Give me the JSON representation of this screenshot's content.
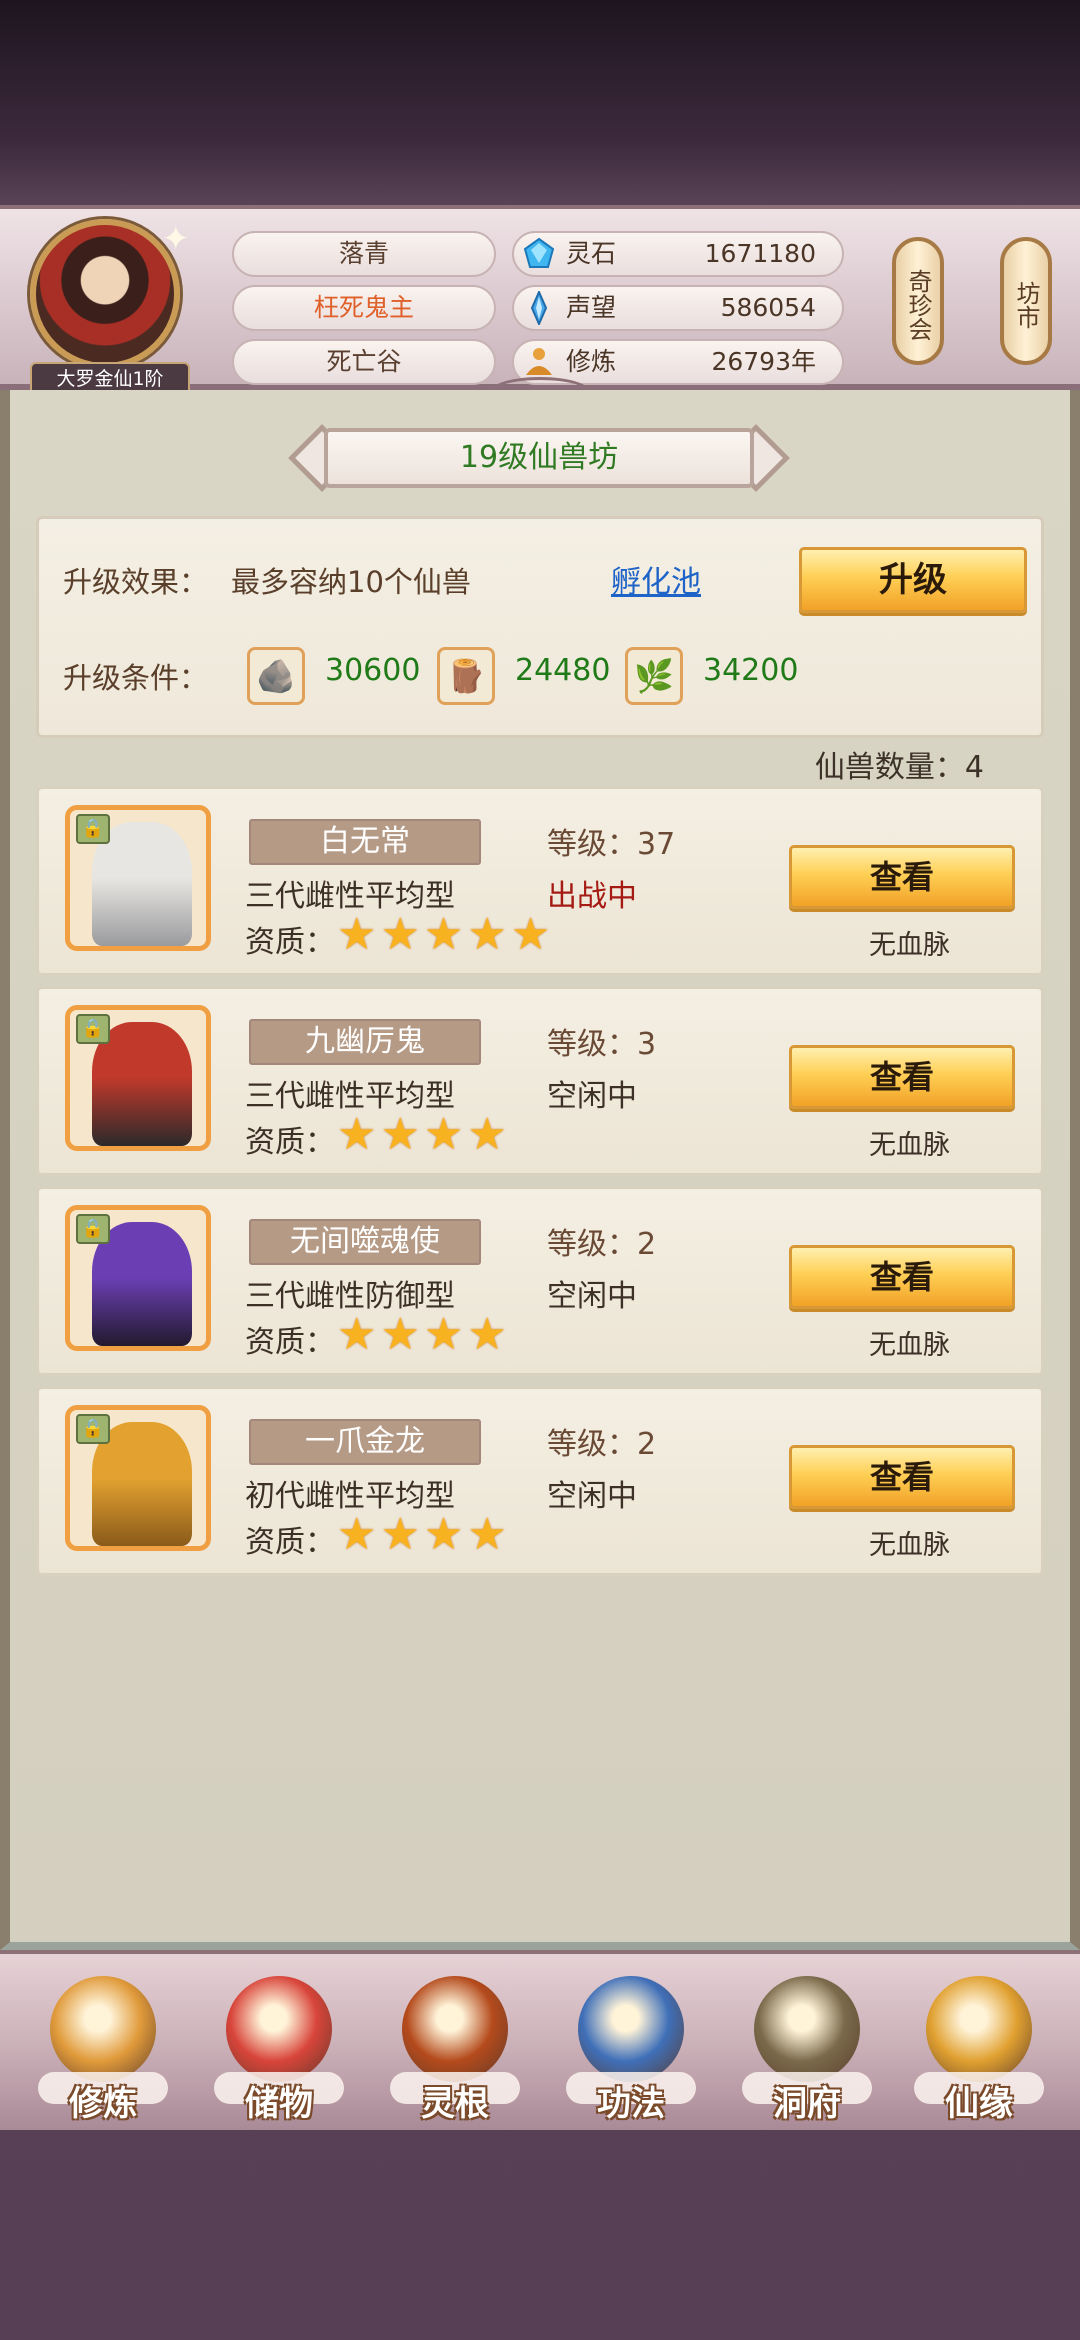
{
  "header": {
    "rank": "大罗金仙1阶",
    "name": "落青",
    "title": "枉死鬼主",
    "location": "死亡谷",
    "resources": [
      {
        "icon": "spirit-stone-icon",
        "label": "灵石",
        "value": "1671180"
      },
      {
        "icon": "prestige-crystal-icon",
        "label": "声望",
        "value": "586054"
      },
      {
        "icon": "meditation-icon",
        "label": "修炼",
        "value": "26793年"
      }
    ],
    "side_buttons": [
      "奇珍会",
      "坊市"
    ]
  },
  "workshop": {
    "title": "19级仙兽坊",
    "effect_label": "升级效果：",
    "effect_text": "最多容纳10个仙兽",
    "hatch_link": "孵化池",
    "upgrade_button": "升级",
    "condition_label": "升级条件：",
    "materials": [
      {
        "icon": "ore-icon",
        "value": "30600"
      },
      {
        "icon": "wood-icon",
        "value": "24480"
      },
      {
        "icon": "herb-icon",
        "value": "34200"
      }
    ],
    "beast_count_label": "仙兽数量：4"
  },
  "beasts": [
    {
      "name": "白无常",
      "type": "三代雌性平均型",
      "quality_label": "资质：",
      "stars": 5,
      "level": "等级：37",
      "status": "出战中",
      "active": true,
      "view_button": "查看",
      "bloodline": "无血脉",
      "colors": [
        "#e8e6e2",
        "#9a9b9e"
      ]
    },
    {
      "name": "九幽厉鬼",
      "type": "三代雌性平均型",
      "quality_label": "资质：",
      "stars": 4,
      "level": "等级：3",
      "status": "空闲中",
      "active": false,
      "view_button": "查看",
      "bloodline": "无血脉",
      "colors": [
        "#c0392b",
        "#2b2a2a"
      ]
    },
    {
      "name": "无间噬魂使",
      "type": "三代雌性防御型",
      "quality_label": "资质：",
      "stars": 4,
      "level": "等级：2",
      "status": "空闲中",
      "active": false,
      "view_button": "查看",
      "bloodline": "无血脉",
      "colors": [
        "#6b3fb3",
        "#221a2e"
      ]
    },
    {
      "name": "一爪金龙",
      "type": "初代雌性平均型",
      "quality_label": "资质：",
      "stars": 4,
      "level": "等级：2",
      "status": "空闲中",
      "active": false,
      "view_button": "查看",
      "bloodline": "无血脉",
      "colors": [
        "#e3a230",
        "#8a5a1a"
      ]
    }
  ],
  "nav": [
    {
      "label": "修炼",
      "icon": "cultivate-icon",
      "color": "#e09a3a"
    },
    {
      "label": "储物",
      "icon": "bag-icon",
      "color": "#d8443a"
    },
    {
      "label": "灵根",
      "icon": "spirit-root-icon",
      "color": "#b44a1c"
    },
    {
      "label": "功法",
      "icon": "book-icon",
      "color": "#3f6fb8"
    },
    {
      "label": "洞府",
      "icon": "cave-house-icon",
      "color": "#7a6a4a"
    },
    {
      "label": "仙缘",
      "icon": "gourd-icon",
      "color": "#e0a030"
    }
  ]
}
